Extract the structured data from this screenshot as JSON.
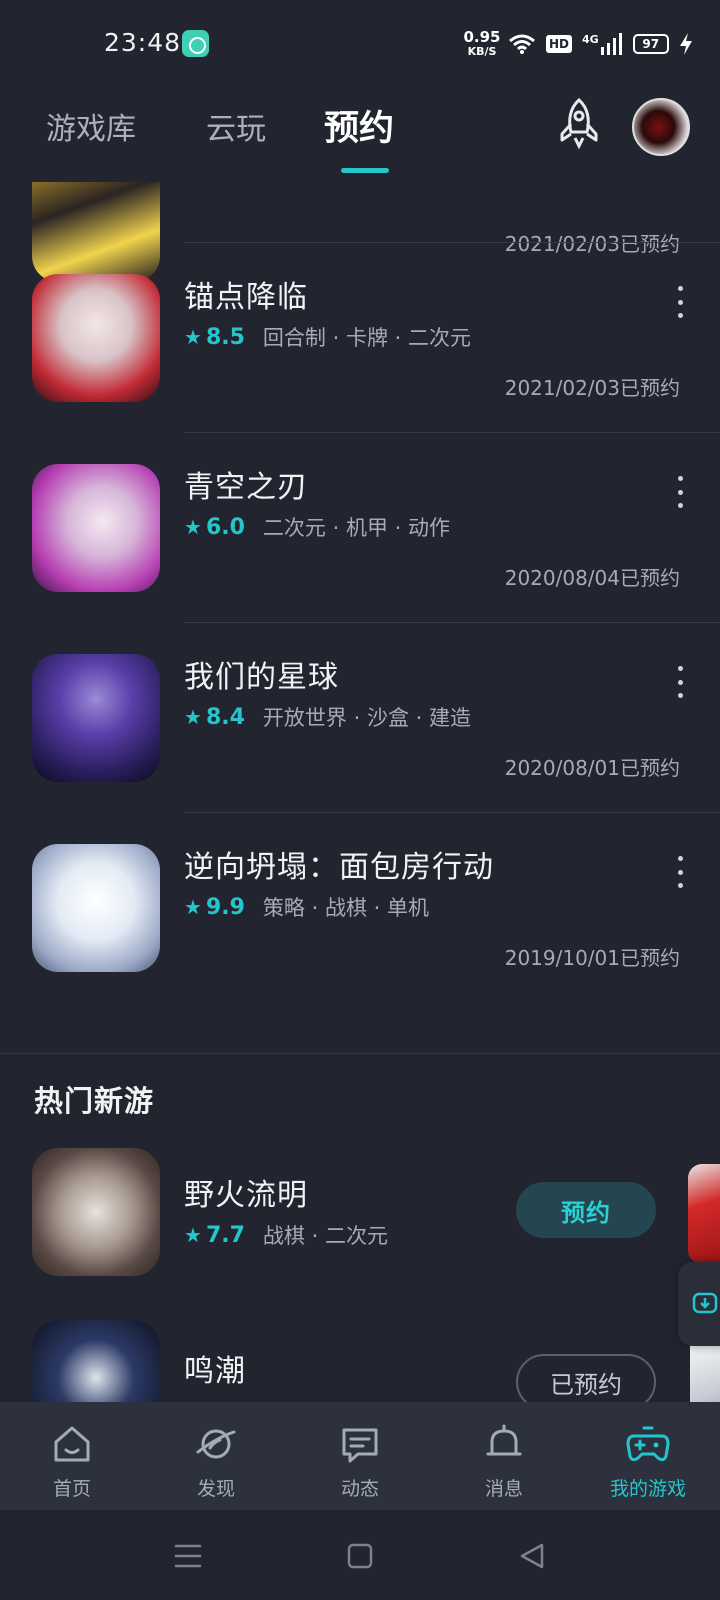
{
  "status": {
    "time": "23:48",
    "net_speed": "0.95",
    "net_unit": "KB/S",
    "hd": "HD",
    "network": "4G",
    "battery": "97"
  },
  "tabs": [
    {
      "label": "游戏库"
    },
    {
      "label": "云玩"
    },
    {
      "label": "预约"
    }
  ],
  "reserved_list": [
    {
      "name": "",
      "rating": "",
      "tags": "",
      "date": "2021/02/03已预约"
    },
    {
      "name": "锚点降临",
      "rating": "8.5",
      "tags": "回合制 · 卡牌 · 二次元",
      "date": "2021/02/03已预约"
    },
    {
      "name": "青空之刃",
      "rating": "6.0",
      "tags": "二次元 · 机甲 · 动作",
      "date": "2020/08/04已预约"
    },
    {
      "name": "我们的星球",
      "rating": "8.4",
      "tags": "开放世界 · 沙盒 · 建造",
      "date": "2020/08/01已预约"
    },
    {
      "name": "逆向坍塌：面包房行动",
      "rating": "9.9",
      "tags": "策略 · 战棋 · 单机",
      "date": "2019/10/01已预约"
    }
  ],
  "hot_section": {
    "title": "热门新游",
    "items": [
      {
        "name": "野火流明",
        "rating": "7.7",
        "tags": "战棋 · 二次元",
        "button": "预约"
      },
      {
        "name": "鸣潮",
        "button": "已预约"
      }
    ]
  },
  "bottom_nav": [
    {
      "label": "首页"
    },
    {
      "label": "发现"
    },
    {
      "label": "动态"
    },
    {
      "label": "消息"
    },
    {
      "label": "我的游戏"
    }
  ],
  "colors": {
    "background": "#22252f",
    "accent": "#25c6cb",
    "nav_bg": "#2d313d"
  }
}
